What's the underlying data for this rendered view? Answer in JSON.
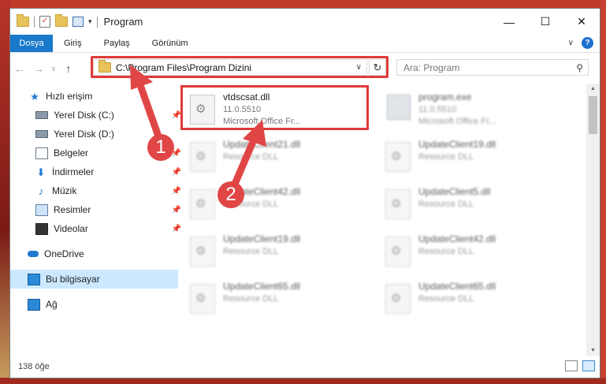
{
  "window": {
    "title": "Program",
    "controls": {
      "minimize": "—",
      "maximize": "☐",
      "close": "✕"
    }
  },
  "ribbon": {
    "tabs": [
      "Dosya",
      "Giriş",
      "Paylaş",
      "Görünüm"
    ],
    "help": "?"
  },
  "navigation": {
    "back": "←",
    "forward": "→",
    "recent": "∨",
    "up": "↑",
    "address": "C:\\Program Files\\Program Dizini",
    "refresh": "↻",
    "search_placeholder": "Ara: Program"
  },
  "sidebar": {
    "items": [
      {
        "label": "Hızlı erişim",
        "icon": "star-icon"
      },
      {
        "label": "Yerel Disk (C:)",
        "icon": "drive-icon",
        "pinned": true
      },
      {
        "label": "Yerel Disk (D:)",
        "icon": "drive-icon"
      },
      {
        "label": "Belgeler",
        "icon": "documents-icon",
        "pinned": true
      },
      {
        "label": "İndirmeler",
        "icon": "download-icon",
        "pinned": true
      },
      {
        "label": "Müzik",
        "icon": "music-icon",
        "pinned": true
      },
      {
        "label": "Resimler",
        "icon": "pictures-icon",
        "pinned": true
      },
      {
        "label": "Videolar",
        "icon": "video-icon",
        "pinned": true
      },
      {
        "label": "OneDrive",
        "icon": "cloud-icon"
      },
      {
        "label": "Bu bilgisayar",
        "icon": "computer-icon",
        "selected": true
      },
      {
        "label": "Ağ",
        "icon": "network-icon"
      }
    ]
  },
  "files": [
    {
      "name": "vtdscsat.dll",
      "line2": "11.0.5510",
      "line3": "Microsoft Office Fr..."
    },
    {
      "name": "program.exe",
      "line2": "11.0.5510",
      "line3": "Microsoft Office Fr..."
    },
    {
      "name": "UpdateClient21.dll",
      "line2": "Resource DLL"
    },
    {
      "name": "UpdateClient19.dll",
      "line2": "Resource DLL"
    },
    {
      "name": "UpdateClient42.dll",
      "line2": "Resource DLL"
    },
    {
      "name": "UpdateClient5.dll",
      "line2": "Resource DLL"
    },
    {
      "name": "UpdateClient19.dll",
      "line2": "Resource DLL"
    },
    {
      "name": "UpdateClient42.dll",
      "line2": "Resource DLL"
    },
    {
      "name": "UpdateClient65.dll",
      "line2": "Resource DLL"
    },
    {
      "name": "UpdateClient65.dll",
      "line2": "Resource DLL"
    }
  ],
  "status": {
    "count": "138 öğe"
  },
  "annotations": {
    "badge1": "1",
    "badge2": "2"
  },
  "colors": {
    "accent": "#1979ca",
    "annotation": "#e03a3a"
  }
}
